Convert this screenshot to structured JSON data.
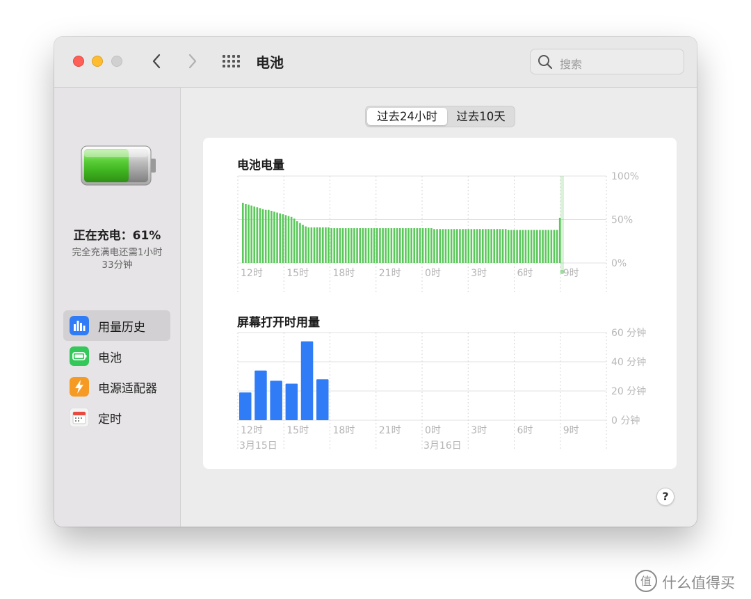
{
  "window": {
    "title": "电池"
  },
  "search": {
    "placeholder": "搜索"
  },
  "status": {
    "charging": "正在充电：61%",
    "detail_line1": "完全充满电还需1小时",
    "detail_line2": "33分钟"
  },
  "sidebar": {
    "items": [
      {
        "label": "用量历史",
        "icon": "usage-history-icon",
        "color": "#2f7cf6",
        "active": true
      },
      {
        "label": "电池",
        "icon": "battery-icon",
        "color": "#34c759"
      },
      {
        "label": "电源适配器",
        "icon": "power-adapter-icon",
        "color": "#f59a23"
      },
      {
        "label": "定时",
        "icon": "schedule-calendar-icon",
        "color": "#e84a3f"
      }
    ]
  },
  "segment": {
    "options": [
      "过去24小时",
      "过去10天"
    ],
    "selected": 0
  },
  "help": {
    "label": "?"
  },
  "watermark": {
    "text": "什么值得买"
  },
  "chart_data": [
    {
      "type": "bar",
      "title": "电池电量",
      "color": "#5ac85a",
      "y_tick_labels": [
        "100%",
        "50%",
        "0%"
      ],
      "ylim": [
        0,
        100
      ],
      "x_tick_labels": [
        "12时",
        "15时",
        "18时",
        "21时",
        "0时",
        "3时",
        "6时",
        "9时"
      ],
      "values": [
        69,
        68,
        67,
        66,
        65,
        64,
        63,
        62,
        61,
        61,
        60,
        59,
        58,
        57,
        56,
        55,
        54,
        53,
        51,
        48,
        46,
        44,
        42,
        41,
        41,
        41,
        41,
        41,
        41,
        41,
        41,
        40,
        40,
        40,
        40,
        40,
        40,
        40,
        40,
        40,
        40,
        40,
        40,
        40,
        40,
        40,
        40,
        40,
        40,
        40,
        40,
        40,
        40,
        40,
        40,
        40,
        40,
        40,
        40,
        40,
        40,
        40,
        40,
        40,
        40,
        40,
        40,
        39,
        39,
        39,
        39,
        39,
        39,
        39,
        39,
        39,
        39,
        39,
        39,
        39,
        39,
        39,
        39,
        39,
        39,
        39,
        39,
        39,
        39,
        39,
        39,
        39,
        39,
        38,
        38,
        38,
        38,
        38,
        38,
        38,
        38,
        38,
        38,
        38,
        38,
        38,
        38,
        38,
        38,
        38,
        38,
        52
      ],
      "grid": true
    },
    {
      "type": "bar",
      "title": "屏幕打开时用量",
      "color": "#2f7cf6",
      "y_tick_labels": [
        "60 分钟",
        "40 分钟",
        "20 分钟",
        "0 分钟"
      ],
      "ylim": [
        0,
        60
      ],
      "x_tick_labels": [
        "12时",
        "15时",
        "18时",
        "21时",
        "0时",
        "3时",
        "6时",
        "9时"
      ],
      "date_labels": [
        "3月15日",
        "3月16日"
      ],
      "values": [
        19,
        34,
        27,
        25,
        54,
        28
      ],
      "grid": true
    }
  ]
}
